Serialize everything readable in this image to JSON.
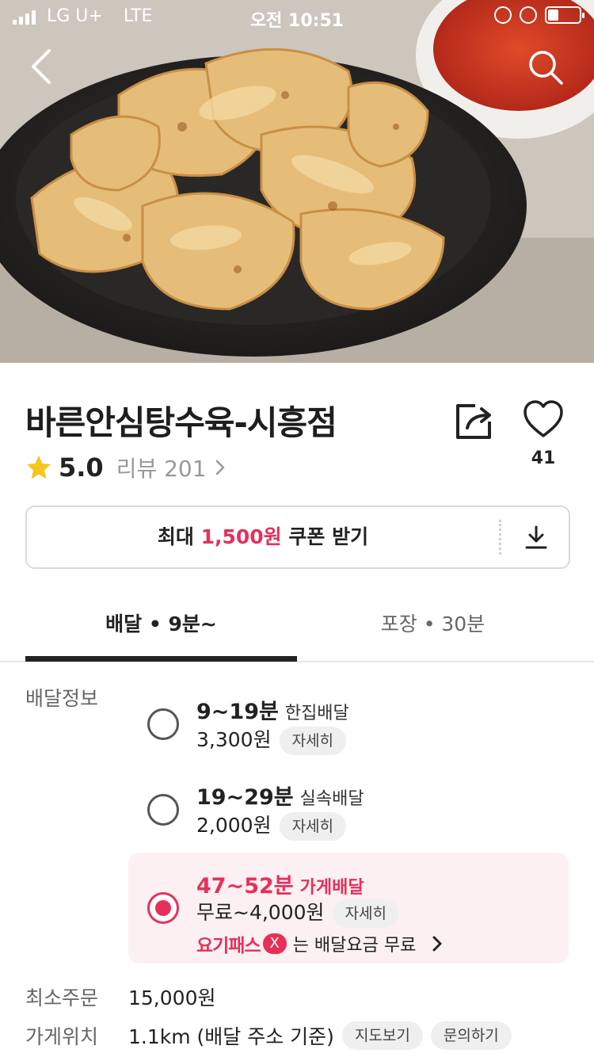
{
  "status_bar": {
    "carrier": "LG U+",
    "network": "LTE",
    "time": "오전 10:51",
    "battery_level": 0.35
  },
  "hero": {
    "icons": [
      "back-arrow-icon",
      "search-icon"
    ]
  },
  "store": {
    "name": "바른안심탕수육-시흥점",
    "rating": "5.0",
    "review_label": "리뷰 201",
    "like_count": "41"
  },
  "coupon": {
    "prefix": "최대 ",
    "amount": "1,500원",
    "suffix": " 쿠폰 받기"
  },
  "tabs": {
    "delivery": "배달 • 9분~",
    "pickup": "포장 • 30분"
  },
  "delivery_info": {
    "label": "배달정보",
    "options": [
      {
        "time": "9~19분",
        "type": "한집배달",
        "fee": "3,300원",
        "detail": "자세히",
        "selected": false
      },
      {
        "time": "19~29분",
        "type": "실속배달",
        "fee": "2,000원",
        "detail": "자세히",
        "selected": false
      },
      {
        "time": "47~52분",
        "type": "가게배달",
        "fee": "무료~4,000원",
        "detail": "자세히",
        "selected": true
      }
    ],
    "promo": {
      "brand": "요기패스",
      "brand_mark": "X",
      "text": "는 배달요금 무료"
    }
  },
  "min_order": {
    "label": "최소주문",
    "value": "15,000원"
  },
  "location": {
    "label": "가게위치",
    "value": "1.1km (배달 주소 기준)",
    "map_button": "지도보기",
    "inquiry_button": "문의하기"
  },
  "colors": {
    "accent": "#e5315a",
    "selected_bg": "#fdf0f2",
    "star": "#f7c51e"
  }
}
